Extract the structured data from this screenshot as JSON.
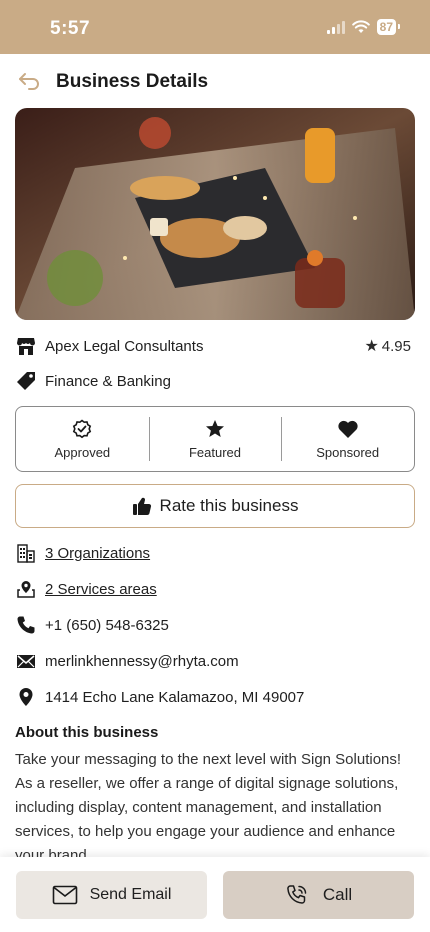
{
  "status_bar": {
    "time": "5:57",
    "battery": "87"
  },
  "header": {
    "title": "Business Details"
  },
  "hero": {
    "alt": "Table with drinks and appetizers"
  },
  "business": {
    "name": "Apex Legal Consultants",
    "rating": "4.95",
    "category": "Finance & Banking"
  },
  "badges": [
    {
      "label": "Approved",
      "icon": "check-badge-icon"
    },
    {
      "label": "Featured",
      "icon": "star-icon"
    },
    {
      "label": "Sponsored",
      "icon": "heart-icon"
    }
  ],
  "rate_button": {
    "label": "Rate this business"
  },
  "details": {
    "organizations": "3 Organizations",
    "service_areas": "2 Services areas",
    "phone": "+1 (650) 548-6325",
    "email": "merlinkhennessy@rhyta.com",
    "address": "1414 Echo Lane Kalamazoo, MI 49007"
  },
  "about": {
    "title": "About this business",
    "text": "Take your messaging to the next level with Sign Solutions! As a reseller, we offer a range of digital signage solutions, including display, content management, and installation services, to help you engage your audience and enhance your brand."
  },
  "actions": {
    "email_label": "Send Email",
    "call_label": "Call"
  },
  "colors": {
    "accent": "#c9ab86",
    "email_button": "#ebe7e2",
    "call_button": "#d8cec4"
  }
}
